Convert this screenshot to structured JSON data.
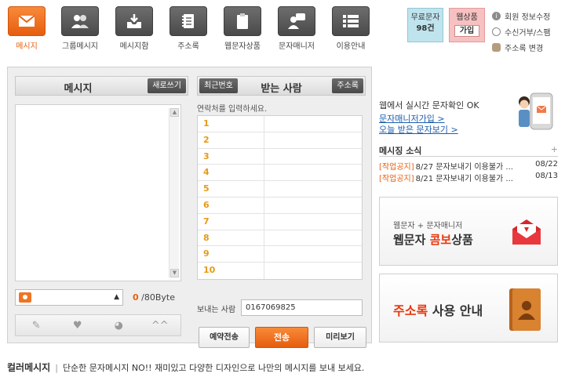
{
  "nav": {
    "items": [
      {
        "label": "메시지",
        "icon": "envelope-icon",
        "active": true
      },
      {
        "label": "그룹메시지",
        "icon": "group-icon",
        "active": false
      },
      {
        "label": "메시지함",
        "icon": "inbox-icon",
        "active": false
      },
      {
        "label": "주소록",
        "icon": "address-book-icon",
        "active": false
      },
      {
        "label": "웹문자상품",
        "icon": "clipboard-icon",
        "active": false
      },
      {
        "label": "문자매니저",
        "icon": "manager-icon",
        "active": false
      },
      {
        "label": "이용안내",
        "icon": "list-icon",
        "active": false
      }
    ]
  },
  "promo": {
    "free_sms": {
      "label": "무료문자",
      "value": "98건"
    },
    "product": {
      "label": "웹상품",
      "value": "가입"
    }
  },
  "account": {
    "items": [
      {
        "label": "회원 정보수정",
        "icon": "info-icon"
      },
      {
        "label": "수신거부/스팸",
        "icon": "block-icon"
      },
      {
        "label": "주소록 변경",
        "icon": "person-icon"
      }
    ]
  },
  "message_panel": {
    "title": "메시지",
    "new_button": "새로쓰기",
    "byte_current": "0",
    "byte_max": "/80Byte"
  },
  "recipient_panel": {
    "recent_button": "최근번호",
    "title": "받는 사람",
    "address_button": "주소록",
    "hint": "연락처를 입력하세요.",
    "rows": [
      "1",
      "2",
      "3",
      "4",
      "5",
      "6",
      "7",
      "8",
      "9",
      "10"
    ],
    "sender_label": "보내는 사람",
    "sender_number": "0167069825",
    "reserve_button": "예약전송",
    "send_button": "전송",
    "preview_button": "미리보기"
  },
  "right": {
    "live_text": "웹에서 실시간 문자확인 OK",
    "join_link": "문자매니저가입 >",
    "today_link": "오늘 받은 문자보기 >",
    "news_title": "메시징 소식",
    "news_more": "+",
    "news": [
      {
        "tag": "[작업공지]",
        "title": "8/27 문자보내기 이용불가 ...",
        "date": "08/22"
      },
      {
        "tag": "[작업공지]",
        "title": "8/21 문자보내기 이용불가 ...",
        "date": "08/13"
      }
    ],
    "combo_banner": {
      "small": "웹문자 + 문자매니저",
      "big_pre": "웹문자 ",
      "big_highlight": "콤보",
      "big_post": "상품"
    },
    "address_banner": {
      "highlight": "주소록",
      "rest": " 사용 안내"
    }
  },
  "footer": {
    "title": "컬러메시지",
    "separator": "|",
    "text": "단순한 문자메시지 NO!! 재미있고 다양한 디자인으로 나만의 메시지를 보내 보세요."
  },
  "colors": {
    "accent": "#e8600f",
    "nav_tile": "#555555",
    "link": "#1c5fae"
  }
}
